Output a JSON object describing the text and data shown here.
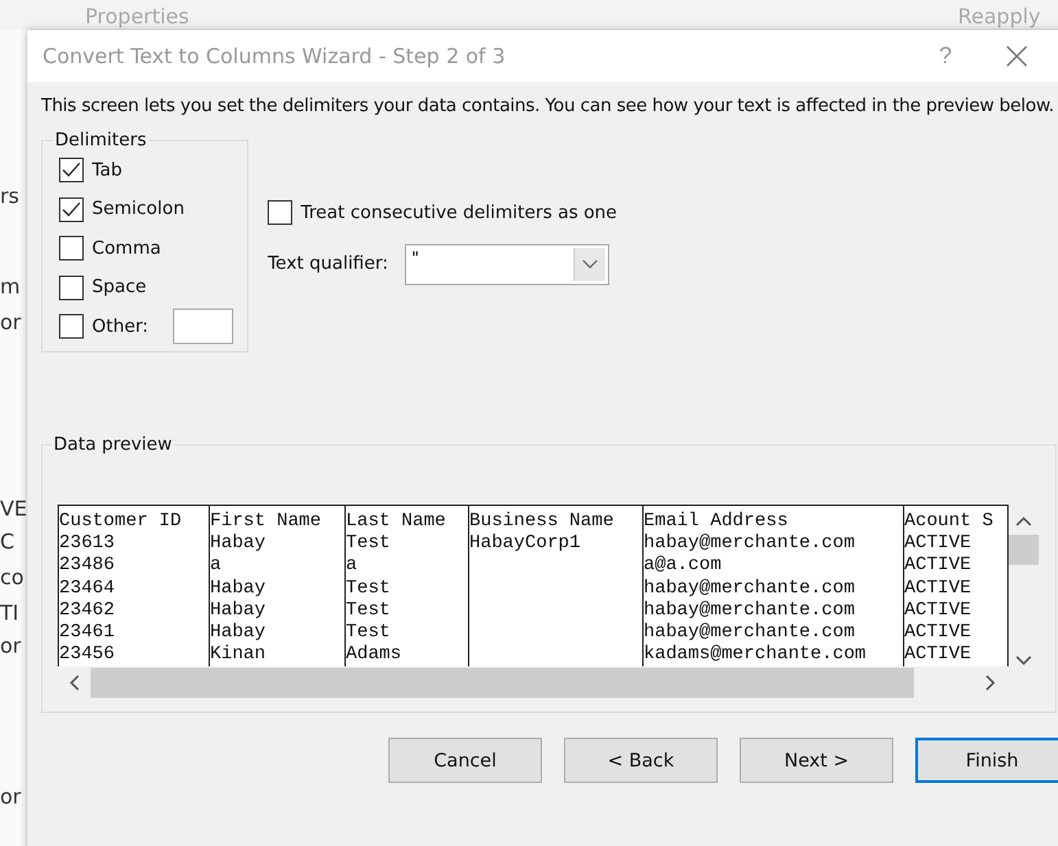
{
  "background": {
    "ribbon_items": [
      "Properties",
      "Reapply"
    ],
    "sheet_cells": [
      "rs",
      "m",
      "or",
      "VE",
      "C",
      "co",
      "TI",
      "or",
      "or"
    ]
  },
  "window": {
    "title": "Convert Text to Columns Wizard - Step 2 of 3",
    "help": "?"
  },
  "description": "This screen lets you set the delimiters your data contains.  You can see how your text is affected in the preview below.",
  "delimiters": {
    "title": "Delimiters",
    "items": [
      {
        "label": "Tab",
        "checked": true
      },
      {
        "label": "Semicolon",
        "checked": true
      },
      {
        "label": "Comma",
        "checked": false
      },
      {
        "label": "Space",
        "checked": false
      },
      {
        "label": "Other:",
        "checked": false,
        "kind": "other"
      }
    ]
  },
  "consecutive": {
    "label": "Treat consecutive delimiters as one",
    "checked": false
  },
  "text_qualifier": {
    "label": "Text qualifier:",
    "value": "\""
  },
  "preview": {
    "title": "Data preview",
    "columns": [
      [
        "Customer ID",
        "23613",
        "23486",
        "23464",
        "23462",
        "23461",
        "23456"
      ],
      [
        "First Name",
        "Habay",
        "a",
        "Habay",
        "Habay",
        "Habay",
        "Kinan"
      ],
      [
        "Last Name",
        "Test",
        "a",
        "Test",
        "Test",
        "Test",
        "Adams"
      ],
      [
        "Business Name",
        "HabayCorp1"
      ],
      [
        "Email Address",
        "habay@merchante.com",
        "a@a.com",
        "habay@merchante.com",
        "habay@merchante.com",
        "habay@merchante.com",
        "kadams@merchante.com"
      ],
      [
        "Acount S",
        "ACTIVE",
        "ACTIVE",
        "ACTIVE",
        "ACTIVE",
        "ACTIVE",
        "ACTIVE"
      ]
    ]
  },
  "buttons": [
    {
      "label": "Cancel",
      "default": false
    },
    {
      "label": "< Back",
      "default": false
    },
    {
      "label": "Next >",
      "default": false
    },
    {
      "label": "Finish",
      "default": true
    }
  ]
}
